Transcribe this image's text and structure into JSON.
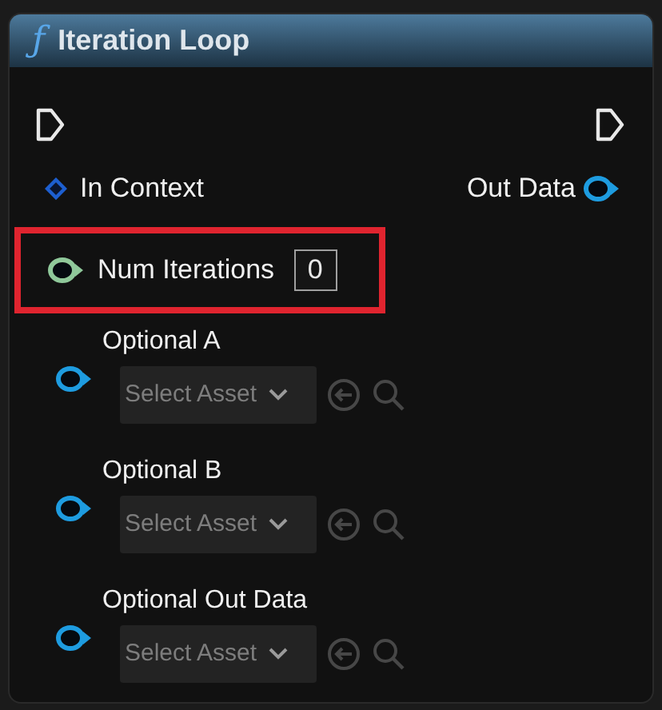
{
  "node": {
    "title": "Iteration Loop",
    "function_icon": "ƒ"
  },
  "exec": {
    "input": true,
    "output": true
  },
  "context_row": {
    "input": {
      "label": "In Context",
      "kind": "diamond"
    },
    "output": {
      "label": "Out Data",
      "kind": "struct"
    }
  },
  "inputs": [
    {
      "kind": "int",
      "label": "Num Iterations",
      "value": "0",
      "highlighted": true
    },
    {
      "kind": "asset",
      "label": "Optional A",
      "placeholder": "Select Asset",
      "highlighted": false
    },
    {
      "kind": "asset",
      "label": "Optional B",
      "placeholder": "Select Asset",
      "highlighted": false
    },
    {
      "kind": "asset",
      "label": "Optional Out Data",
      "placeholder": "Select Asset",
      "highlighted": false
    }
  ]
}
